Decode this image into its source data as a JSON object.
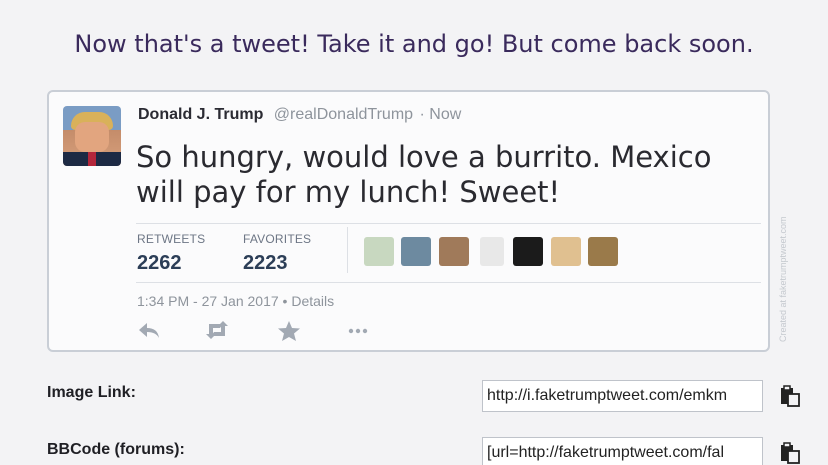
{
  "headline": "Now that's a tweet! Take it and go! But come back soon.",
  "tweet": {
    "name": "Donald J. Trump",
    "handle": "@realDonaldTrump",
    "time": "· Now",
    "text": "So hungry, would love a burrito. Mexico will pay for my lunch! Sweet!",
    "retweets_label": "RETWEETS",
    "retweets": "2262",
    "favorites_label": "FAVORITES",
    "favorites": "2223",
    "timestamp": "1:34 PM - 27 Jan 2017 • Details",
    "watermark": "Created at faketrumptweet.com",
    "actions": [
      "reply-icon",
      "retweet-icon",
      "favorite-icon",
      "more-icon"
    ],
    "mini_avatar_colors": [
      "#c8d8c0",
      "#6d8aa0",
      "#a07a5a",
      "#e8e8e8",
      "#1b1b1b",
      "#e0c090",
      "#9a7a4a"
    ]
  },
  "fields": [
    {
      "label": "Image Link:",
      "value": "http://i.faketrumptweet.com/emkm"
    },
    {
      "label": "BBCode (forums):",
      "value": "[url=http://faketrumptweet.com/fal"
    }
  ],
  "colors": {
    "headline": "#3a2a5c",
    "card_border": "#c9ced6",
    "stat_value": "#2c3e57"
  }
}
